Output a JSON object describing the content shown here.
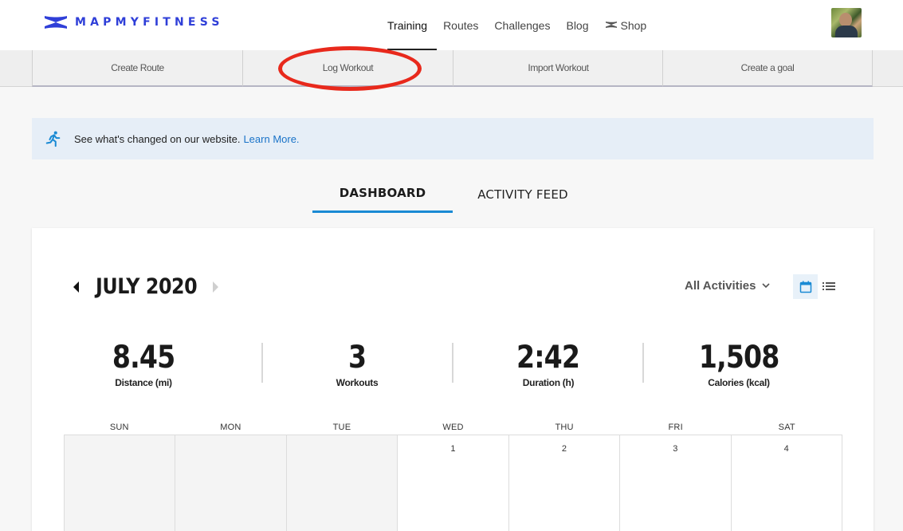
{
  "brand": {
    "name": "MAPMYFITNESS"
  },
  "nav": {
    "links": [
      {
        "label": "Training"
      },
      {
        "label": "Routes"
      },
      {
        "label": "Challenges"
      },
      {
        "label": "Blog"
      },
      {
        "label": "Shop"
      }
    ]
  },
  "actions": {
    "items": [
      {
        "label": "Create Route"
      },
      {
        "label": "Log Workout"
      },
      {
        "label": "Import Workout"
      },
      {
        "label": "Create a goal"
      }
    ]
  },
  "banner": {
    "text": "See what's changed on our website.",
    "link": "Learn More.",
    "icon": "runner-icon"
  },
  "tabs": [
    {
      "label": "DASHBOARD"
    },
    {
      "label": "ACTIVITY FEED"
    }
  ],
  "dashboard": {
    "month": "JULY 2020",
    "filter": "All Activities",
    "stats": [
      {
        "value": "8.45",
        "label": "Distance (mi)"
      },
      {
        "value": "3",
        "label": "Workouts"
      },
      {
        "value": "2:42",
        "label": "Duration (h)"
      },
      {
        "value": "1,508",
        "label": "Calories (kcal)"
      }
    ],
    "days": [
      "SUN",
      "MON",
      "TUE",
      "WED",
      "THU",
      "FRI",
      "SAT"
    ],
    "first_row": [
      "",
      "",
      "",
      "1",
      "2",
      "3",
      "4"
    ]
  },
  "colors": {
    "brand": "#2f3fd8",
    "accent": "#1a8ad4",
    "highlight": "#e8291c"
  }
}
